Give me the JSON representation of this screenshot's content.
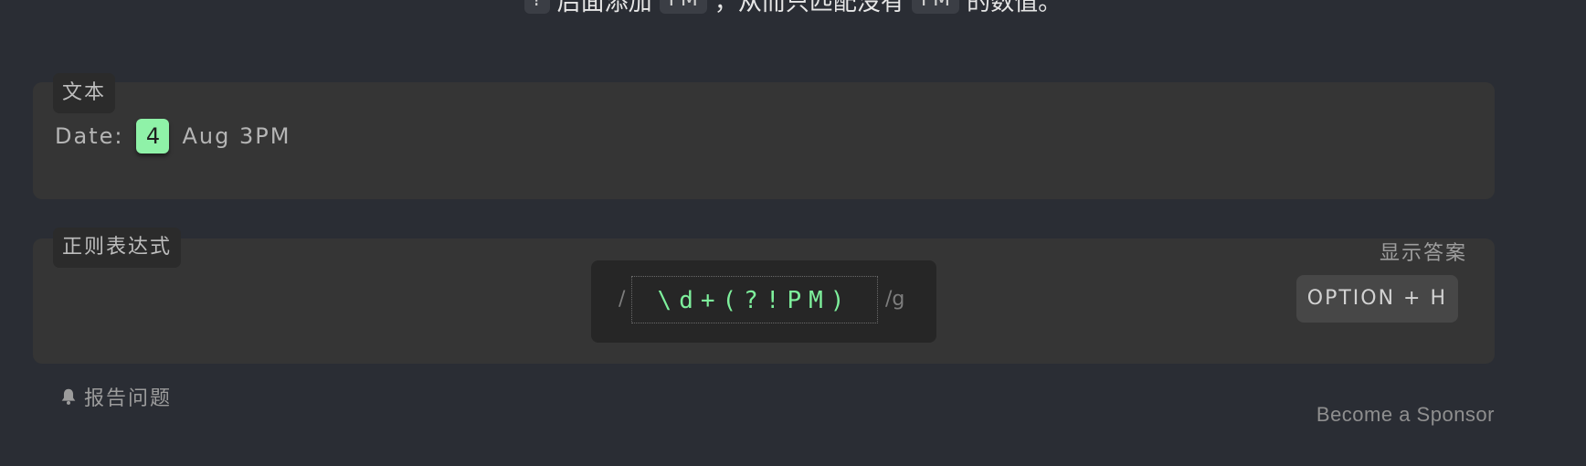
{
  "instruction": {
    "part1": "?",
    "part2": "后面添加",
    "chip1": "PM",
    "part3": "，从而只匹配没有",
    "chip2": "PM",
    "part4": "的数值。"
  },
  "text_panel": {
    "tag": "文本",
    "prefix": "Date:",
    "match": "4",
    "suffix": "Aug 3PM"
  },
  "regex_panel": {
    "tag": "正则表达式",
    "open_slash": "/",
    "pattern": "\\d+(?!PM)",
    "flags": "/g",
    "show_answer": "显示答案",
    "shortcut": "OPTION + H"
  },
  "footer": {
    "report_label": "报告问题",
    "sponsor_label": "Become a Sponsor"
  },
  "colors": {
    "background": "#2a2d34",
    "panel": "#353535",
    "match_highlight": "#8ff2a8",
    "regex_text": "#7ef09c"
  },
  "icons": {
    "report": "bell-icon"
  }
}
